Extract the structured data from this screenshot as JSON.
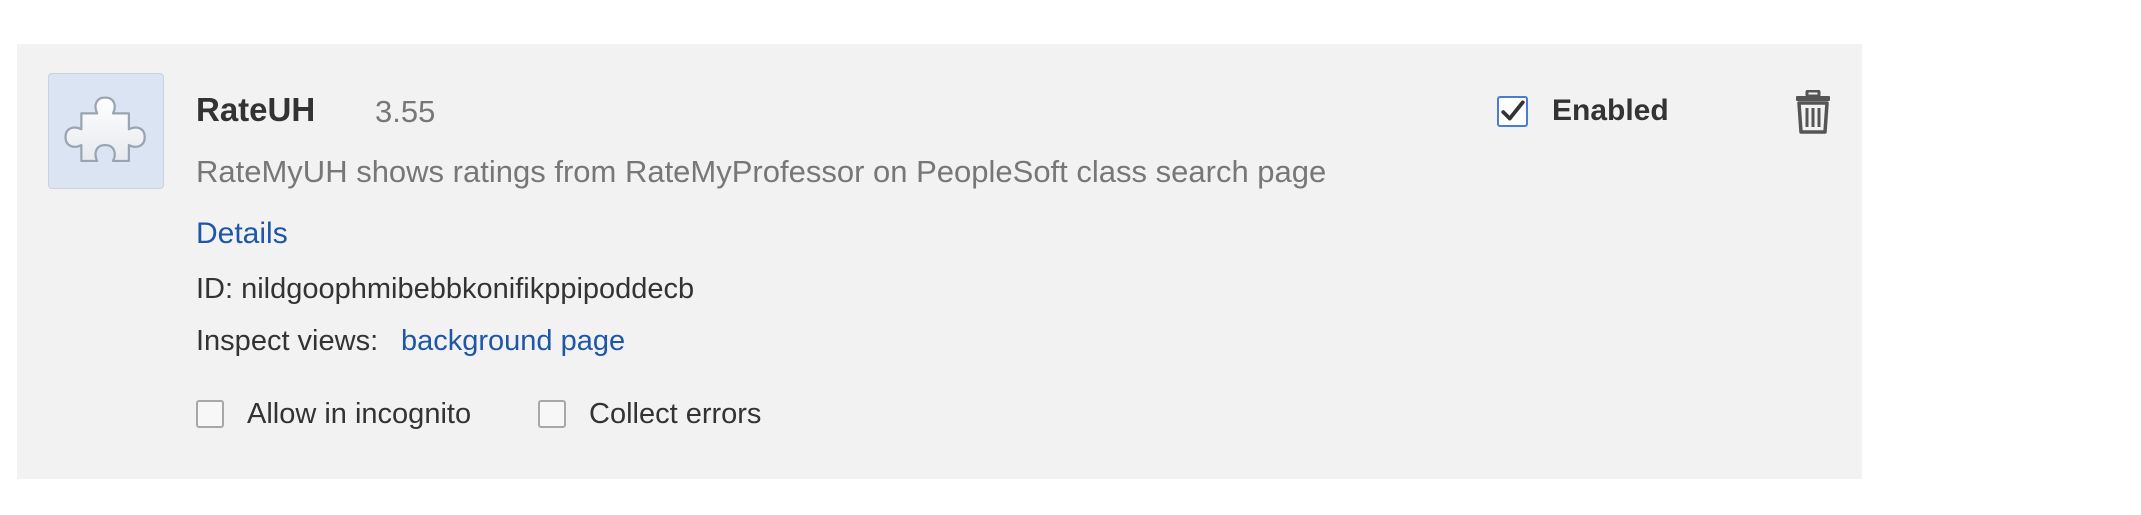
{
  "extension": {
    "name": "RateUH",
    "version": "3.55",
    "description": "RateMyUH shows ratings from RateMyProfessor on PeopleSoft class search page",
    "details_label": "Details",
    "id_text": "ID: nildgoophmibebbkonifikppipoddecb",
    "inspect_label": "Inspect views:",
    "inspect_link": "background page",
    "icon": "puzzle-piece-icon"
  },
  "controls": {
    "enabled_label": "Enabled",
    "enabled_checked": true,
    "incognito_label": "Allow in incognito",
    "incognito_checked": false,
    "errors_label": "Collect errors",
    "errors_checked": false,
    "remove_icon": "trash-icon"
  },
  "colors": {
    "card_background": "#f2f2f2",
    "link": "#1e56a8",
    "icon_background": "#dbe4f2"
  }
}
